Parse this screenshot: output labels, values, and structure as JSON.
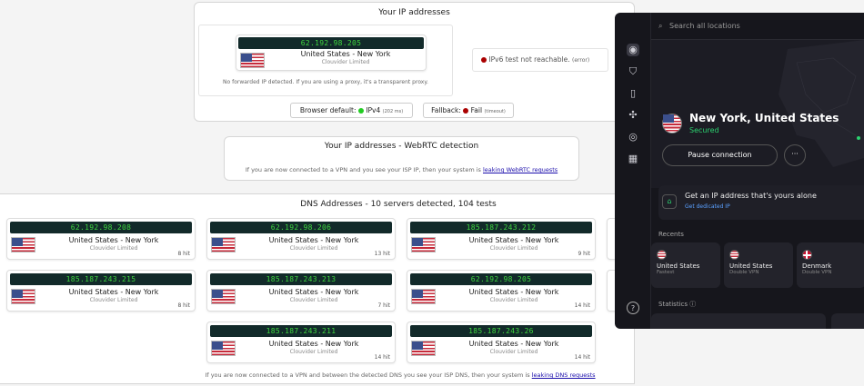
{
  "ip_section": {
    "title": "Your IP addresses",
    "ip": "62.192.98.205",
    "location": "United States - New York",
    "isp": "Clouvider Limited",
    "ipv6_text": "IPv6 test not reachable.",
    "ipv6_status": "(error)",
    "proxy_note": "No forwarded IP detected. If you are using a proxy, it's a transparent proxy.",
    "browser_default_label": "Browser default:",
    "browser_default_value": "IPv4",
    "browser_default_ms": "(202 ms)",
    "fallback_label": "Fallback:",
    "fallback_value": "Fail",
    "fallback_note": "(timeout)"
  },
  "webrtc": {
    "title": "Your IP addresses - WebRTC detection",
    "note": "If you are now connected to a VPN and you see your ISP IP, then your system is",
    "link": "leaking WebRTC requests"
  },
  "dns": {
    "title": "DNS Addresses - 10 servers detected, 104 tests",
    "servers": [
      {
        "ip": "62.192.98.208",
        "location": "United States - New York",
        "isp": "Clouvider Limited",
        "hits": "8 hit"
      },
      {
        "ip": "62.192.98.206",
        "location": "United States - New York",
        "isp": "Clouvider Limited",
        "hits": "13 hit"
      },
      {
        "ip": "185.187.243.212",
        "location": "United States - New York",
        "isp": "Clouvider Limited",
        "hits": "9 hit"
      },
      {
        "ip": "185.187.243.215",
        "location": "United States - New York",
        "isp": "Clouvider Limited",
        "hits": "8 hit"
      },
      {
        "ip": "185.187.243.213",
        "location": "United States - New York",
        "isp": "Clouvider Limited",
        "hits": "7 hit"
      },
      {
        "ip": "62.192.98.205",
        "location": "United States - New York",
        "isp": "Clouvider Limited",
        "hits": "14 hit"
      },
      {
        "ip": "185.187.243.211",
        "location": "United States - New York",
        "isp": "Clouvider Limited",
        "hits": "14 hit"
      },
      {
        "ip": "185.187.243.26",
        "location": "United States - New York",
        "isp": "Clouvider Limited",
        "hits": "14 hit"
      }
    ],
    "note": "If you are now connected to a VPN and between the detected DNS you see your ISP DNS, then your system is",
    "link": "leaking DNS requests"
  },
  "vpn_app": {
    "search_placeholder": "Search all locations",
    "location": "New York, United States",
    "status": "Secured",
    "pause_label": "Pause connection",
    "more_label": "···",
    "promo_title": "Get an IP address that's yours alone",
    "promo_link": "Get dedicated IP",
    "recents_label": "Recents",
    "recents": [
      {
        "name": "United States",
        "sub": "Fastest"
      },
      {
        "name": "United States",
        "sub": "Double VPN"
      },
      {
        "name": "Denmark",
        "sub": "Double VPN"
      }
    ],
    "statistics_label": "Statistics",
    "accent": "#2bd16f"
  }
}
